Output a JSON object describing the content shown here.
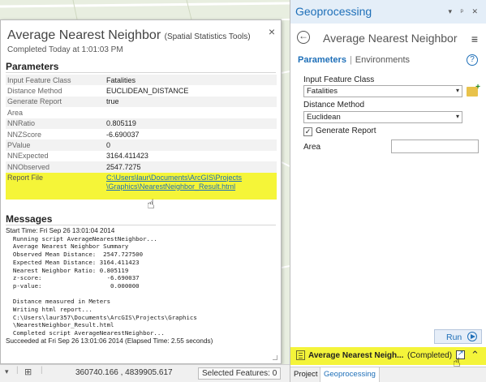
{
  "popup": {
    "title": "Average Nearest Neighbor",
    "subtitle": "(Spatial Statistics Tools)",
    "completed": "Completed Today at 1:01:03 PM",
    "close_glyph": "×",
    "parameters_heading": "Parameters",
    "parameters": [
      {
        "key": "Input Feature Class",
        "value": "Fatalities"
      },
      {
        "key": "Distance Method",
        "value": "EUCLIDEAN_DISTANCE"
      },
      {
        "key": "Generate Report",
        "value": "true"
      },
      {
        "key": "Area",
        "value": ""
      },
      {
        "key": "NNRatio",
        "value": "0.805119"
      },
      {
        "key": "NNZScore",
        "value": "-6.690037"
      },
      {
        "key": "PValue",
        "value": "0"
      },
      {
        "key": "NNExpected",
        "value": "3164.411423"
      },
      {
        "key": "NNObserved",
        "value": "2547.7275"
      }
    ],
    "report_file": {
      "key": "Report File",
      "value_line1": "C:\\Users\\laur\\Documents\\ArcGIS\\Projects",
      "value_line2": "\\Graphics\\NearestNeighbor_Result.html"
    },
    "messages_heading": "Messages",
    "messages": {
      "start": "Start Time: Fri Sep 26 13:01:04 2014",
      "mono_lines": [
        "  Running script AverageNearestNeighbor...",
        "  Average Nearest Neighbor Summary",
        "  Observed Mean Distance:  2547.727500",
        "  Expected Mean Distance: 3164.411423",
        "  Nearest Neighbor Ratio: 0.805119",
        "  z-score:                  -6.690037",
        "  p-value:                   0.000000",
        "",
        "  Distance measured in Meters",
        "  Writing html report...",
        "  C:\\Users\\laur357\\Documents\\ArcGIS\\Projects\\Graphics",
        "  \\NearestNeighbor_Result.html",
        "  Completed script AverageNearestNeighbor..."
      ],
      "end": "Succeeded at Fri Sep 26 13:01:06 2014 (Elapsed Time: 2.55 seconds)"
    }
  },
  "statusbar": {
    "coordinates": "360740.166 , 4839905.617",
    "selected_features": "Selected Features: 0"
  },
  "pane": {
    "title": "Geoprocessing",
    "window_controls": "▾ ᵖ ✕",
    "tool_title": "Average Nearest Neighbor",
    "tab_parameters": "Parameters",
    "tab_separator": "|",
    "tab_environments": "Environments",
    "help_glyph": "?",
    "menu_glyph": "≡",
    "fields": {
      "input_feature_class_label": "Input Feature Class",
      "input_feature_class_value": "Fatalities",
      "distance_method_label": "Distance Method",
      "distance_method_value": "Euclidean",
      "generate_report_label": "Generate Report",
      "generate_report_checked": "✓",
      "area_label": "Area"
    },
    "run_label": "Run",
    "status": {
      "name": "Average Nearest Neigh...",
      "state": "(Completed)",
      "expand_glyph": "⌃"
    },
    "bottom_tabs": [
      "Project",
      "Geoprocessing"
    ]
  },
  "colors": {
    "accent": "#1e6fb8",
    "highlight": "#f5f538"
  },
  "cursor_glyph": "☝"
}
